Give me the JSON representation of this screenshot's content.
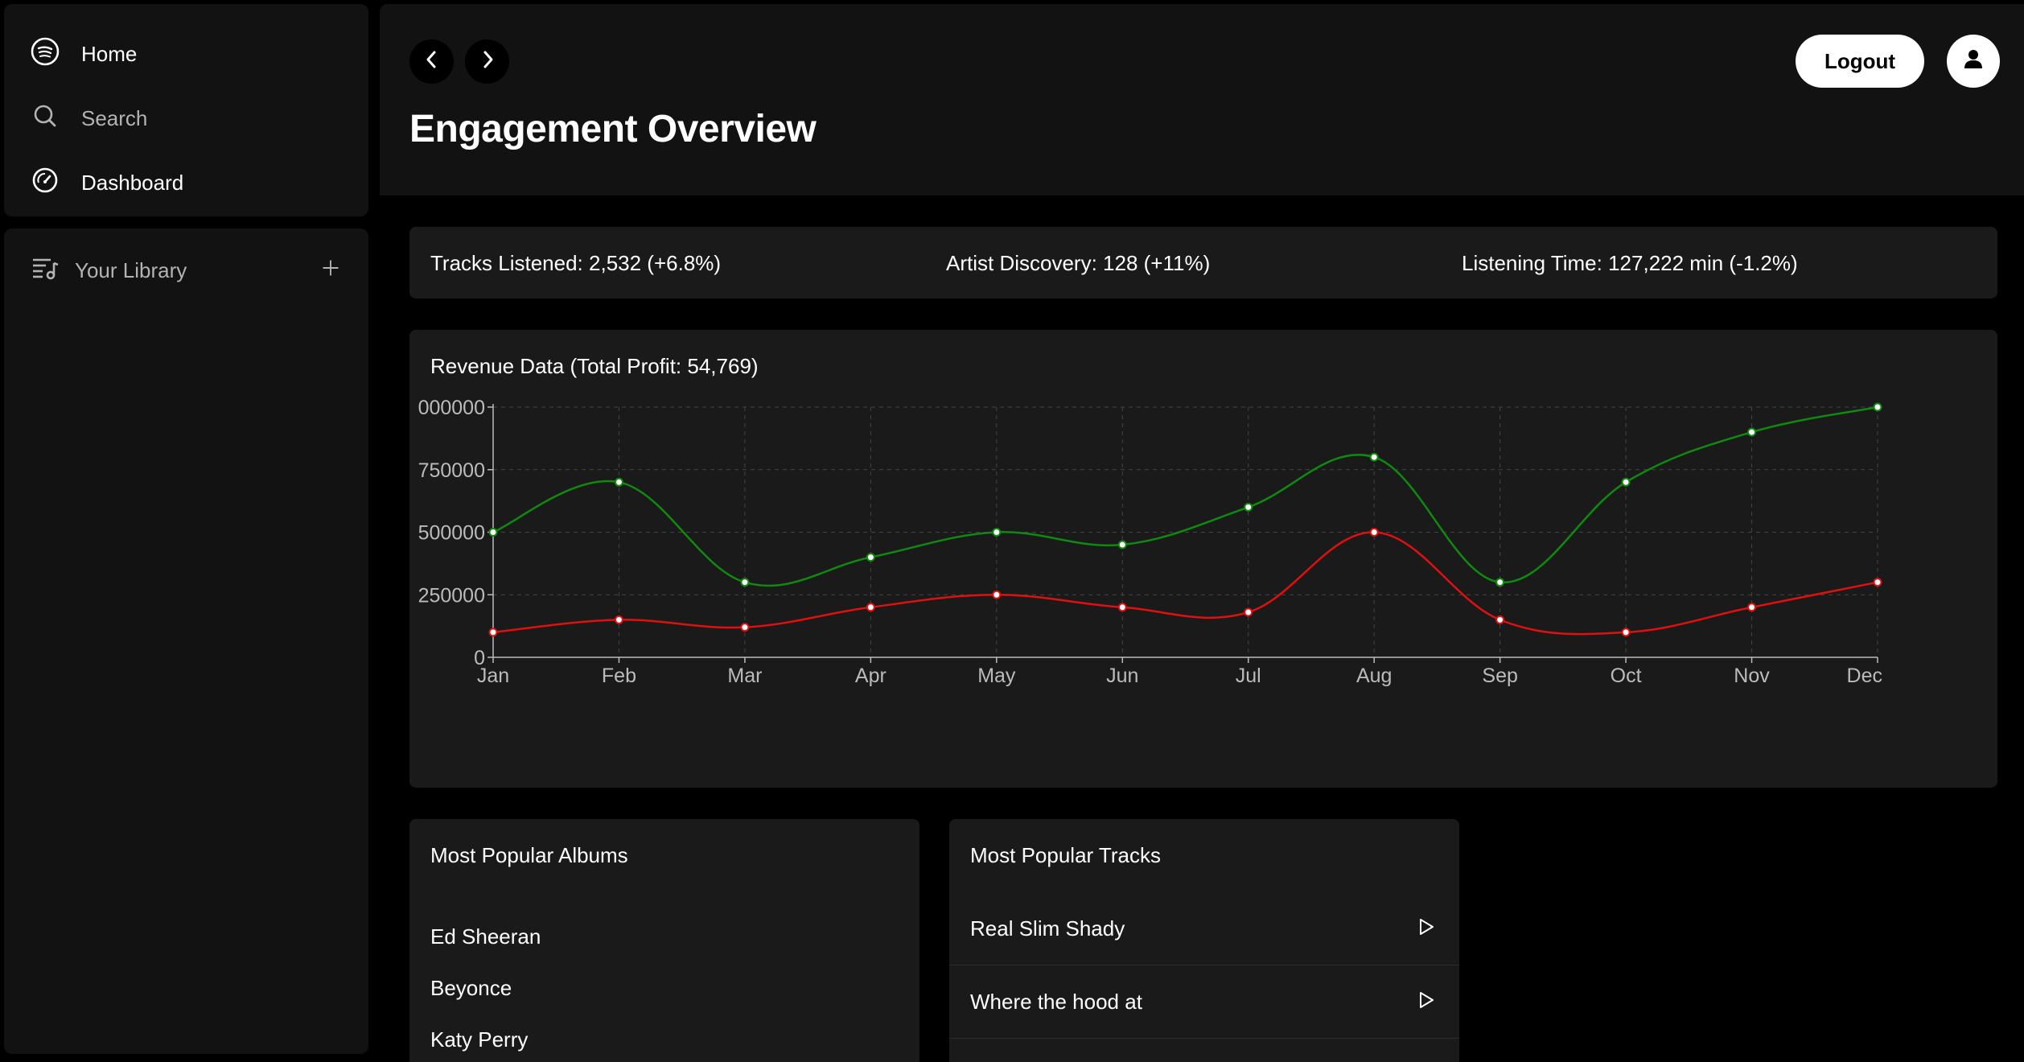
{
  "sidebar": {
    "nav": [
      {
        "label": "Home",
        "icon": "spotify-logo-icon"
      },
      {
        "label": "Search",
        "icon": "search-icon"
      },
      {
        "label": "Dashboard",
        "icon": "gauge-icon"
      }
    ],
    "library": {
      "label": "Your Library",
      "icon": "library-icon",
      "add_icon": "plus-icon"
    }
  },
  "header": {
    "title": "Engagement Overview",
    "logout_label": "Logout"
  },
  "stats": [
    "Tracks Listened: 2,532 (+6.8%)",
    "Artist Discovery: 128 (+11%)",
    "Listening Time: 127,222 min (-1.2%)"
  ],
  "revenue": {
    "title": "Revenue Data (Total Profit: 54,769)"
  },
  "chart_data": {
    "type": "line",
    "categories": [
      "Jan",
      "Feb",
      "Mar",
      "Apr",
      "May",
      "Jun",
      "Jul",
      "Aug",
      "Sep",
      "Oct",
      "Nov",
      "Dec"
    ],
    "y_tick_labels": [
      "0",
      "250000",
      "500000",
      "750000",
      "000000"
    ],
    "ylim": [
      0,
      1000000
    ],
    "grid": true,
    "series": [
      {
        "color": "#0f8a0f",
        "values": [
          500000,
          700000,
          300000,
          400000,
          500000,
          450000,
          600000,
          800000,
          300000,
          700000,
          900000,
          1000000
        ]
      },
      {
        "color": "#e01010",
        "values": [
          100000,
          150000,
          120000,
          200000,
          250000,
          200000,
          180000,
          500000,
          150000,
          100000,
          200000,
          300000
        ]
      }
    ]
  },
  "albums": {
    "title": "Most Popular Albums",
    "items": [
      "Ed Sheeran",
      "Beyonce",
      "Katy Perry"
    ]
  },
  "tracks": {
    "title": "Most Popular Tracks",
    "items": [
      "Real Slim Shady",
      "Where the hood at"
    ]
  },
  "colors": {
    "background": "#000000",
    "panel": "#121212",
    "card": "#1a1a1a"
  }
}
